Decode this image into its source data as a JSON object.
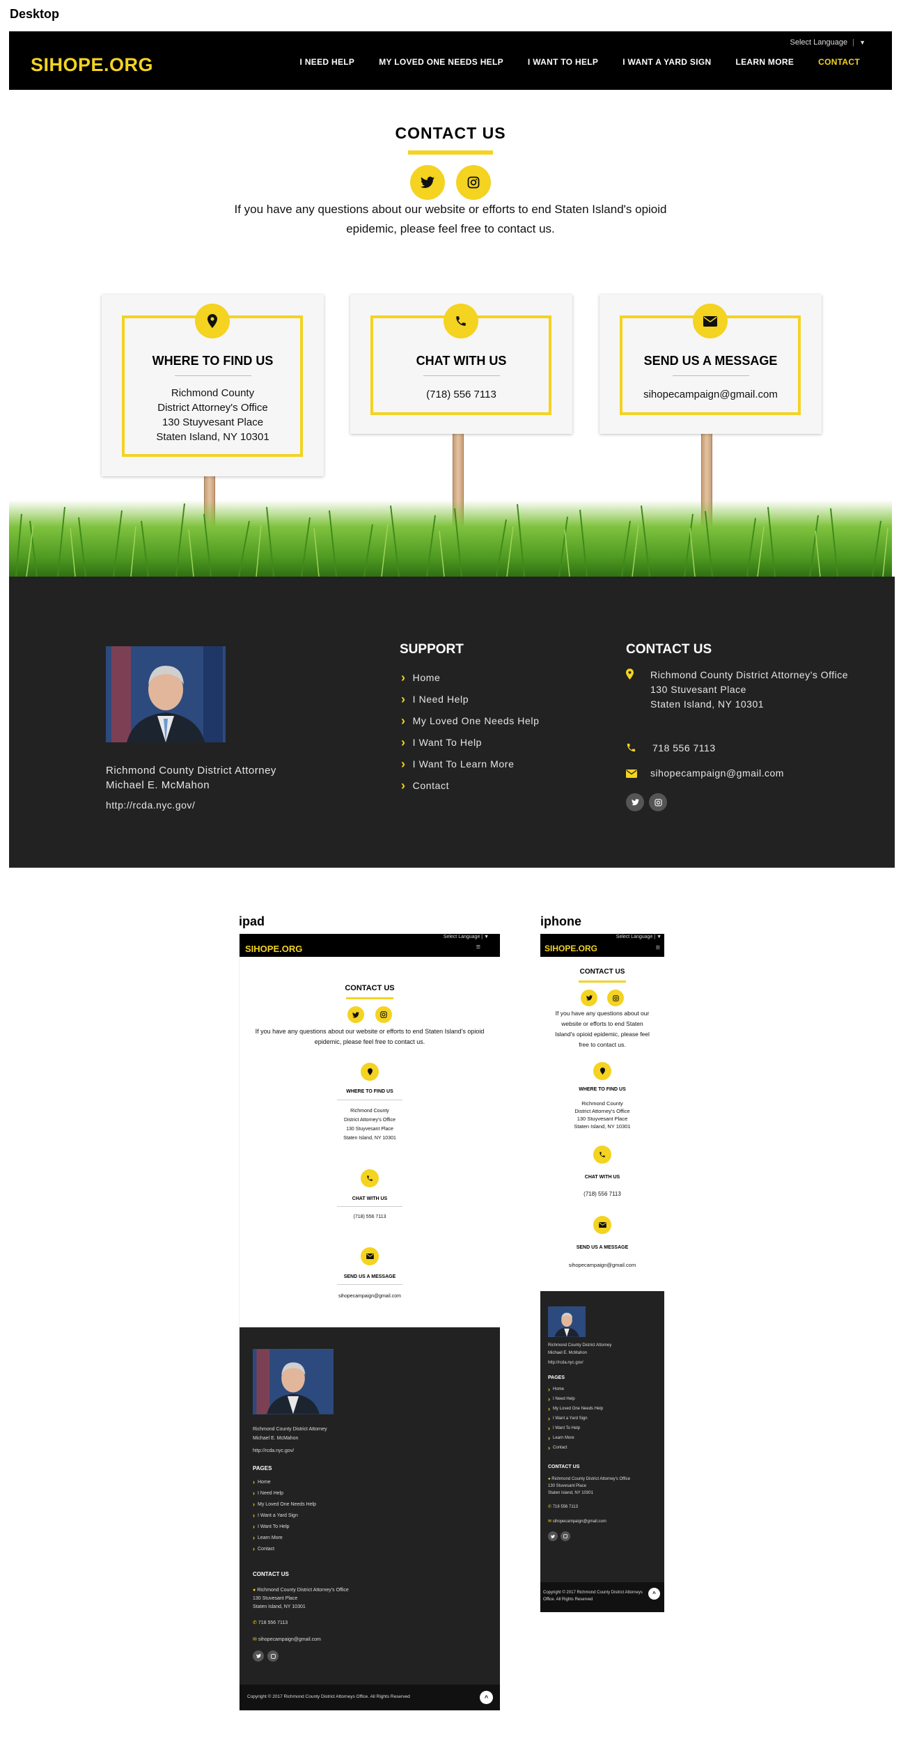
{
  "labels": {
    "desktop": "Desktop",
    "ipad": "ipad",
    "iphone": "iphone"
  },
  "brand": {
    "logo": "SIHOPE.ORG",
    "accent": "#f4d321",
    "footer_bg": "#222222"
  },
  "language": {
    "label": "Select Language",
    "arrow": "▼"
  },
  "nav": [
    "I NEED HELP",
    "MY LOVED ONE NEEDS HELP",
    "I WANT TO HELP",
    "I WANT A YARD SIGN",
    "LEARN MORE",
    "CONTACT"
  ],
  "contact": {
    "title": "CONTACT US",
    "intro": "If you have any questions about our website or efforts to end Staten Island's opioid epidemic, please feel free to contact us.",
    "social": [
      "twitter-icon",
      "instagram-icon"
    ]
  },
  "cards": [
    {
      "icon": "map-pin-icon",
      "title": "WHERE TO FIND US",
      "lines": [
        "Richmond County",
        "District Attorney's Office",
        "130 Stuyvesant Place",
        "Staten Island, NY 10301"
      ]
    },
    {
      "icon": "phone-icon",
      "title": "CHAT WITH US",
      "lines": [
        "(718) 556 7113"
      ]
    },
    {
      "icon": "envelope-icon",
      "title": "SEND US A MESSAGE",
      "lines": [
        "sihopecampaign@gmail.com"
      ]
    }
  ],
  "footer": {
    "person_line1": "Richmond County District Attorney",
    "person_line2": "Michael E. McMahon",
    "url": "http://rcda.nyc.gov/",
    "support_title": "SUPPORT",
    "support_links": [
      "Home",
      "I Need Help",
      "My Loved One Needs Help",
      "I Want To Help",
      "I Want To Learn More",
      "Contact"
    ],
    "pages_title": "PAGES",
    "pages_links": [
      "Home",
      "I Need Help",
      "My Loved One Needs Help",
      "I Want a Yard Sign",
      "I Want To Help",
      "Learn More",
      "Contact"
    ],
    "contact_title": "CONTACT US",
    "address1": "Richmond County District Attorney's Office",
    "address2": "130 Stuvesant Place",
    "address3": "Staten Island, NY 10301",
    "phone": "718 556 7113",
    "email": "sihopecampaign@gmail.com",
    "copyright_ipad": "Copyright © 2017 Richmond County District Attorneys Office. All Rights Reserved",
    "copyright_iphone_1": "Copyright © 2017 Richmond County District Attorneys",
    "copyright_iphone_2": "Office. All Rights Reserved"
  }
}
